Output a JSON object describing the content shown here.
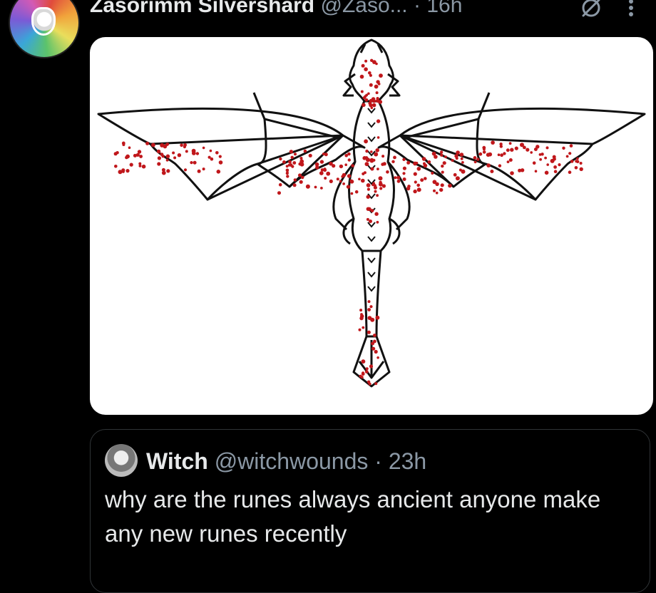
{
  "post": {
    "display_name": "Zasorimm Silvershard",
    "handle": "@Zaso...",
    "separator": "·",
    "time": "16h",
    "icons": [
      "avatar",
      "grok-icon",
      "more-icon"
    ]
  },
  "media": {
    "type": "image",
    "icons": [
      "dragon-diagram"
    ]
  },
  "quoted_post": {
    "display_name": "Witch",
    "handle": "@witchwounds",
    "separator": "·",
    "time": "23h",
    "text": "why are the runes always ancient anyone make any new runes recently"
  },
  "colors": {
    "background": "#000000",
    "text": "#e7e9ea",
    "secondary_text": "#8b98a5",
    "border": "#2f3336",
    "dots": "#c0171b"
  }
}
